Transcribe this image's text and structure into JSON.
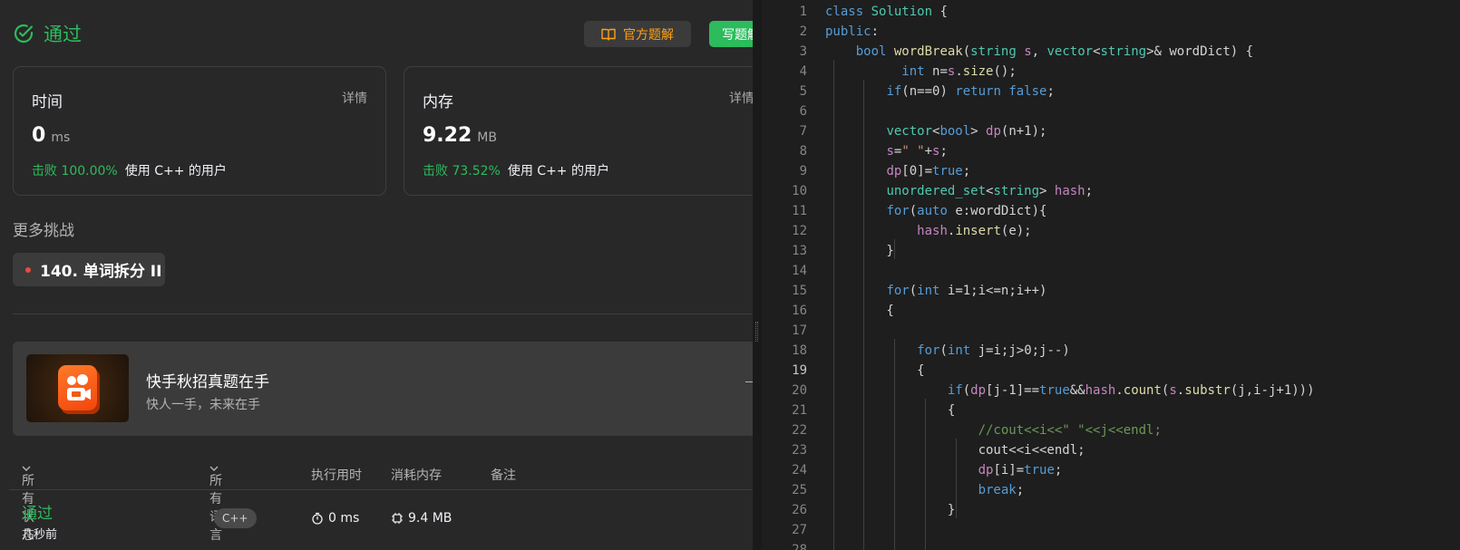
{
  "result": {
    "status": "通过"
  },
  "toolbar": {
    "editorial_label": "官方题解",
    "solution_label": "写题解"
  },
  "runtime": {
    "label": "时间",
    "detail": "详情",
    "value": "0",
    "unit": "ms",
    "beats": "击败 100.00%",
    "beats_suffix": "使用 C++ 的用户"
  },
  "memory": {
    "label": "内存",
    "detail": "详情",
    "value": "9.22",
    "unit": "MB",
    "beats": "击败 73.52%",
    "beats_suffix": "使用 C++ 的用户"
  },
  "more": {
    "title": "更多挑战",
    "challenge": "140. 单词拆分 II"
  },
  "banner": {
    "title": "快手秋招真题在手",
    "subtitle": "快人一手，未来在手"
  },
  "submissions": {
    "headers": {
      "status": "所有状态",
      "language": "所有语言",
      "runtime": "执行用时",
      "memory": "消耗内存",
      "notes": "备注"
    },
    "rows": [
      {
        "status": "通过",
        "time_ago": "几秒前",
        "language": "C++",
        "runtime": "0 ms",
        "memory": "9.4 MB"
      }
    ]
  },
  "editor": {
    "active_line": 19,
    "lines": [
      "class Solution {",
      "public:",
      "    bool wordBreak(string s, vector<string>& wordDict) {",
      "          int n=s.size();",
      "        if(n==0) return false;",
      "",
      "        vector<bool> dp(n+1);",
      "        s=\" \"+s;",
      "        dp[0]=true;",
      "        unordered_set<string> hash;",
      "        for(auto e:wordDict){",
      "            hash.insert(e);",
      "        }",
      "",
      "        for(int i=1;i<=n;i++)",
      "        {",
      "",
      "            for(int j=i;j>0;j--)",
      "            {",
      "                if(dp[j-1]==true&&hash.count(s.substr(j,i-j+1)))",
      "                {",
      "                    //cout<<i<<\" \"<<j<<endl;",
      "                    cout<<i<<endl;",
      "                    dp[i]=true;",
      "                    break;",
      "                }",
      "",
      ""
    ]
  },
  "colors": {
    "accepted": "#2cbb5d",
    "editorial": "#ffa116",
    "challenge_dot": "#ef4743"
  }
}
